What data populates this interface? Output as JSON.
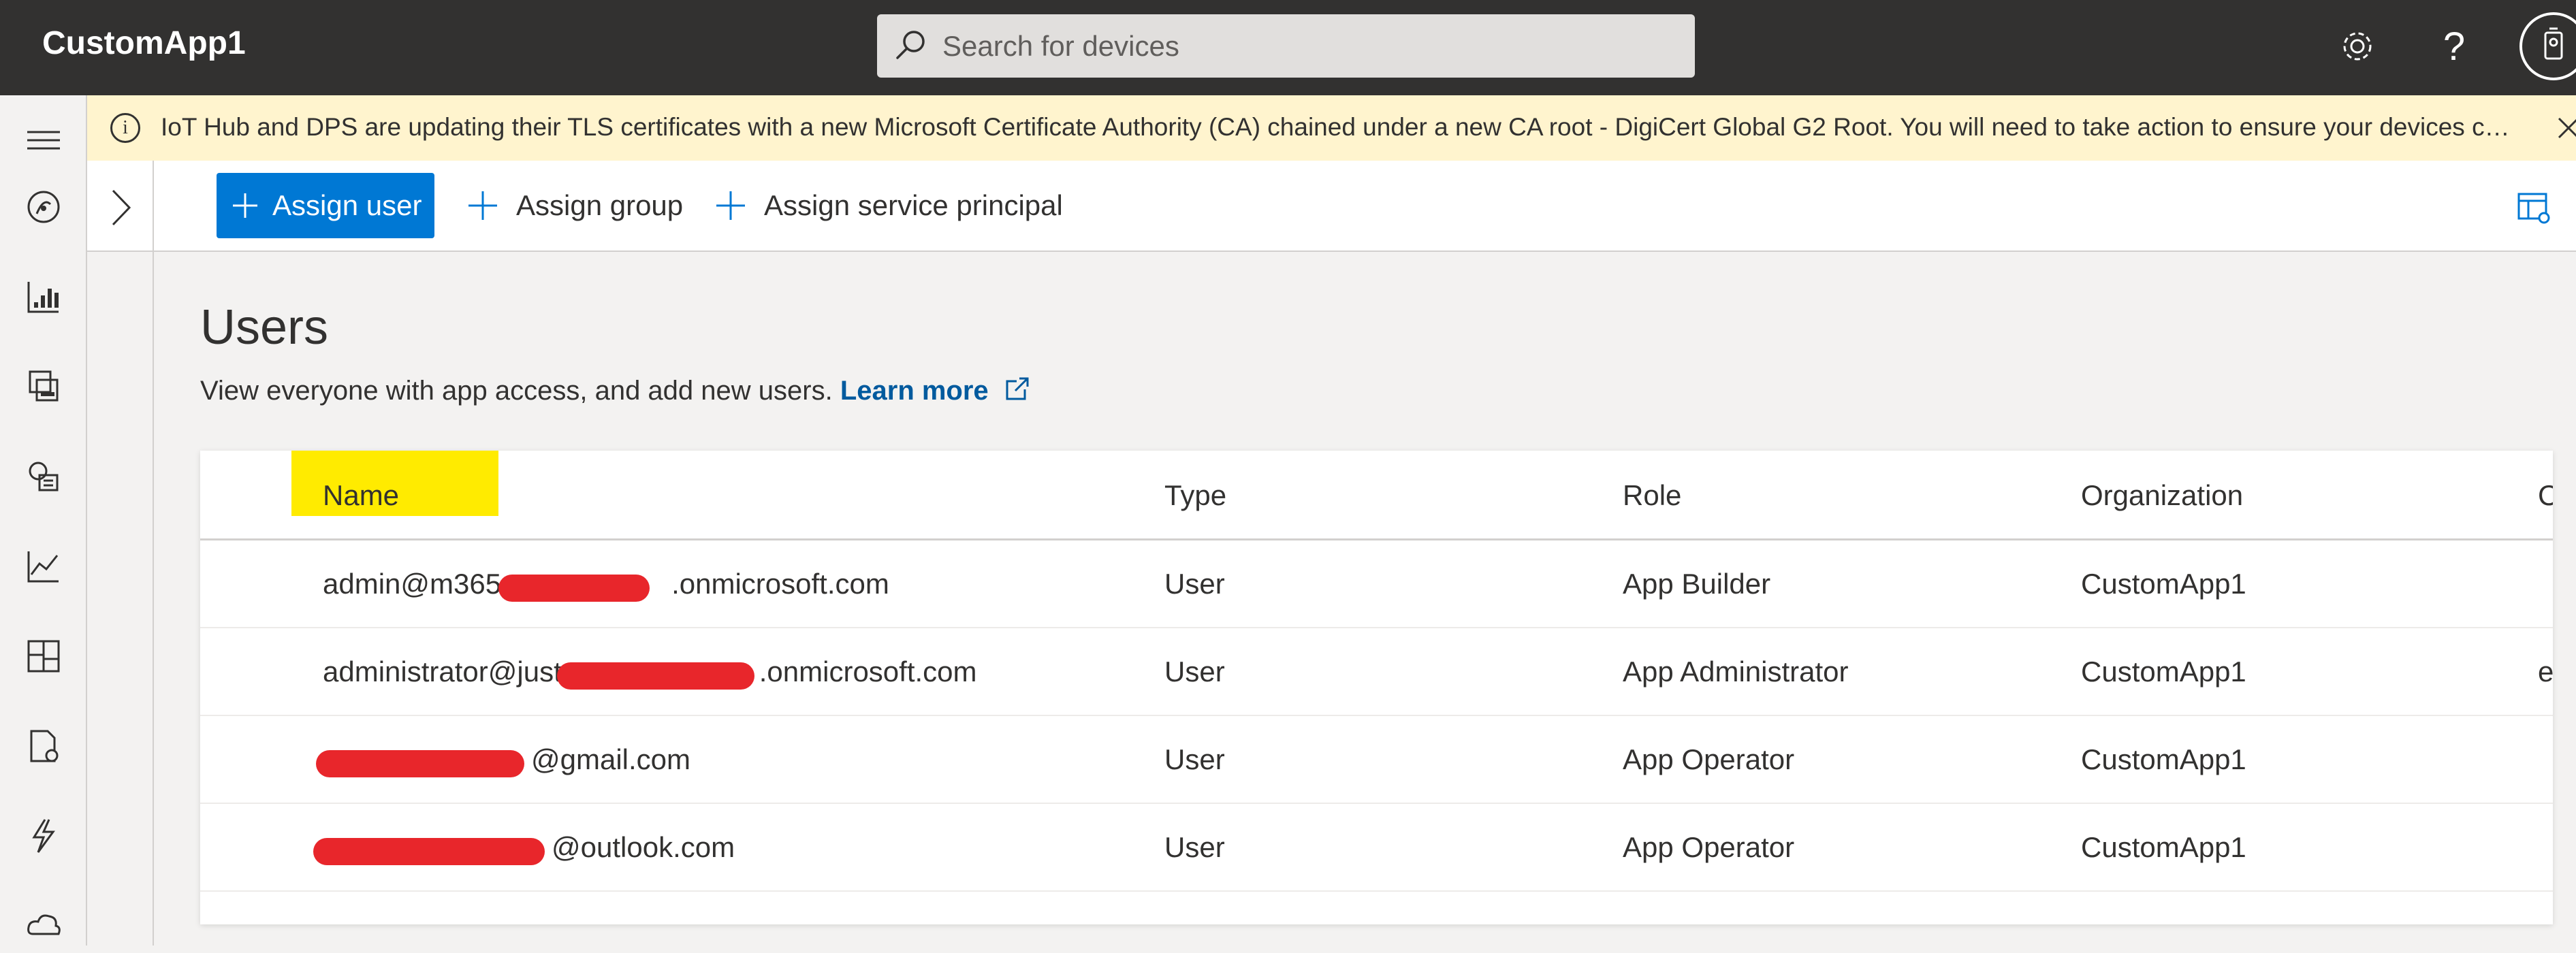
{
  "header": {
    "app_title": "CustomApp1",
    "search_placeholder": "Search for devices"
  },
  "banner": {
    "message": "IoT Hub and DPS are updating their TLS certificates with a new Microsoft Certificate Authority (CA) chained under a new CA root - DigiCert Global G2 Root. You will need to take action to ensure your devices can conti..."
  },
  "toolbar": {
    "assign_user": "Assign user",
    "assign_group": "Assign group",
    "assign_service_principal": "Assign service principal"
  },
  "page": {
    "title": "Users",
    "subtitle": "View everyone with app access, and add new users.",
    "learn_more": "Learn more"
  },
  "table": {
    "columns": [
      "Name",
      "Type",
      "Role",
      "Organization",
      "C"
    ],
    "rows": [
      {
        "name_prefix": "admin@m365",
        "name_suffix": ".onmicrosoft.com",
        "type": "User",
        "role": "App Builder",
        "organization": "CustomApp1",
        "extra": ""
      },
      {
        "name_prefix": "administrator@just",
        "name_suffix": ".onmicrosoft.com",
        "type": "User",
        "role": "App Administrator",
        "organization": "CustomApp1",
        "extra": "e"
      },
      {
        "name_prefix": "",
        "name_suffix": "@gmail.com",
        "type": "User",
        "role": "App Operator",
        "organization": "CustomApp1",
        "extra": ""
      },
      {
        "name_prefix": "",
        "name_suffix": "@outlook.com",
        "type": "User",
        "role": "App Operator",
        "organization": "CustomApp1",
        "extra": ""
      }
    ]
  },
  "colors": {
    "topbar": "#323130",
    "accent": "#0078d4",
    "banner": "#fff4ce",
    "highlight": "#ffeb00",
    "redaction": "#e8262b"
  },
  "icons": [
    "search-icon",
    "gear-icon",
    "help-icon",
    "avatar-icon",
    "info-icon",
    "close-icon",
    "hamburger-icon",
    "dashboard-icon",
    "devices-icon",
    "device-groups-icon",
    "device-templates-icon",
    "analytics-icon",
    "dashboards-nav-icon",
    "jobs-icon",
    "rules-icon",
    "data-export-icon",
    "chevron-right-icon",
    "plus-icon",
    "column-settings-icon",
    "external-link-icon"
  ]
}
